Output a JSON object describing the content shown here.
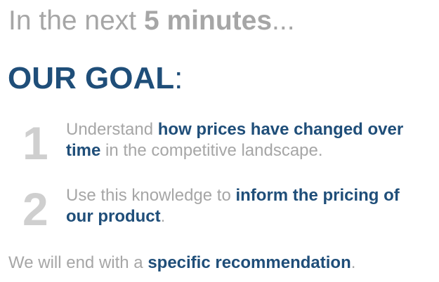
{
  "intro": {
    "prefix": "In the next ",
    "emphasis": "5 minutes",
    "suffix": "..."
  },
  "goal": {
    "title": "OUR GOAL",
    "colon": ":"
  },
  "items": [
    {
      "number": "1",
      "text_before": "Understand ",
      "highlight": "how prices have changed over time",
      "text_after": " in the competitive landscape."
    },
    {
      "number": "2",
      "text_before": "Use this knowledge to ",
      "highlight": "inform the pricing of our product",
      "text_after": "."
    }
  ],
  "closing": {
    "text_before": "We will end with a ",
    "highlight": "specific recommendation",
    "text_after": "."
  },
  "colors": {
    "gray_text": "#a6a6a6",
    "number_gray": "#cfcfcf",
    "navy": "#1f4e79"
  }
}
